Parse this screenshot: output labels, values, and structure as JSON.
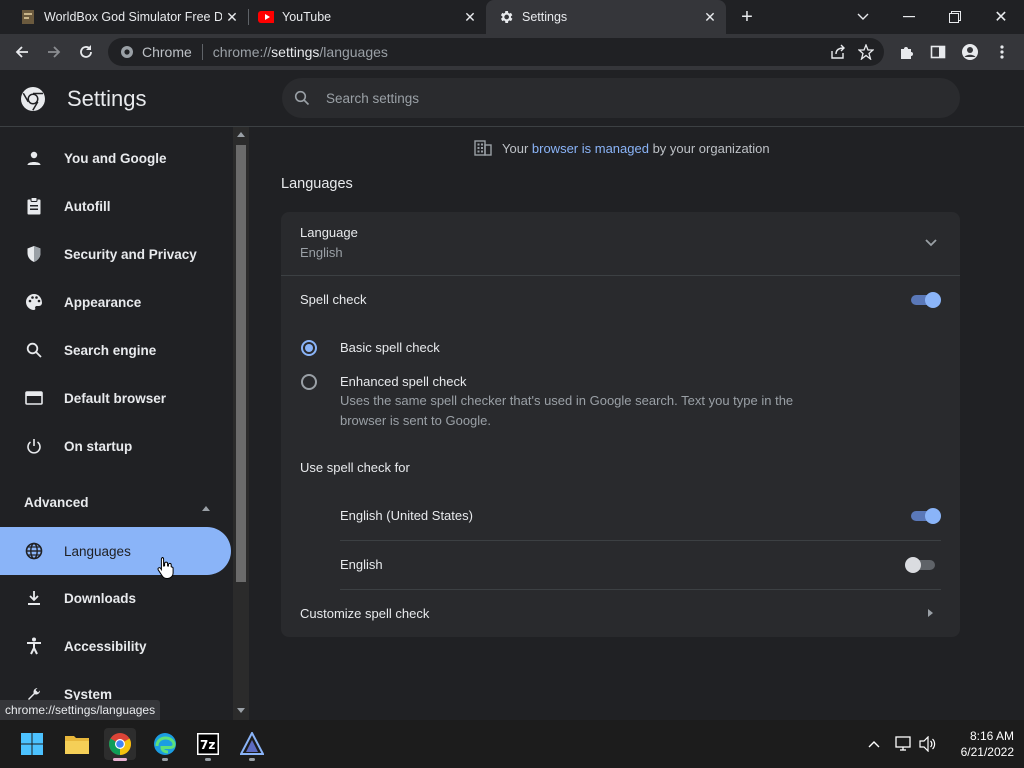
{
  "tabs": [
    {
      "title": "WorldBox God Simulator Free Do",
      "favicon": "worldbox-icon"
    },
    {
      "title": "YouTube",
      "favicon": "youtube-icon"
    },
    {
      "title": "Settings",
      "favicon": "gear-icon",
      "active": true
    }
  ],
  "omnibox": {
    "chip": "Chrome",
    "url_prefix": "chrome://",
    "url_host": "settings",
    "url_path": "/languages"
  },
  "header": {
    "title": "Settings",
    "search_placeholder": "Search settings"
  },
  "sidebar": {
    "items": [
      {
        "label": "You and Google",
        "icon": "person-icon"
      },
      {
        "label": "Autofill",
        "icon": "clipboard-icon"
      },
      {
        "label": "Security and Privacy",
        "icon": "shield-icon"
      },
      {
        "label": "Appearance",
        "icon": "palette-icon"
      },
      {
        "label": "Search engine",
        "icon": "search-icon"
      },
      {
        "label": "Default browser",
        "icon": "browser-icon"
      },
      {
        "label": "On startup",
        "icon": "power-icon"
      }
    ],
    "advanced_label": "Advanced",
    "advanced_items": [
      {
        "label": "Languages",
        "icon": "globe-icon",
        "selected": true
      },
      {
        "label": "Downloads",
        "icon": "download-icon"
      },
      {
        "label": "Accessibility",
        "icon": "accessibility-icon"
      },
      {
        "label": "System",
        "icon": "wrench-icon"
      }
    ]
  },
  "managed": {
    "prefix": "Your ",
    "link": "browser is managed",
    "suffix": " by your organization"
  },
  "section_title": "Languages",
  "language": {
    "label": "Language",
    "value": "English"
  },
  "spell_check": {
    "label": "Spell check",
    "enabled": true,
    "basic_label": "Basic spell check",
    "enhanced_label": "Enhanced spell check",
    "enhanced_desc_line1": "Uses the same spell checker that's used in Google search. Text you type in the",
    "enhanced_desc_line2": "browser is sent to Google.",
    "use_for_label": "Use spell check for",
    "languages": [
      {
        "label": "English (United States)",
        "enabled": true
      },
      {
        "label": "English",
        "enabled": false
      }
    ],
    "customize_label": "Customize spell check"
  },
  "tooltip": "chrome://settings/languages",
  "taskbar": {
    "time": "8:16 AM",
    "date": "6/21/2022"
  },
  "colors": {
    "accent": "#8ab4f8",
    "background": "#202124",
    "card": "#292a2d"
  }
}
